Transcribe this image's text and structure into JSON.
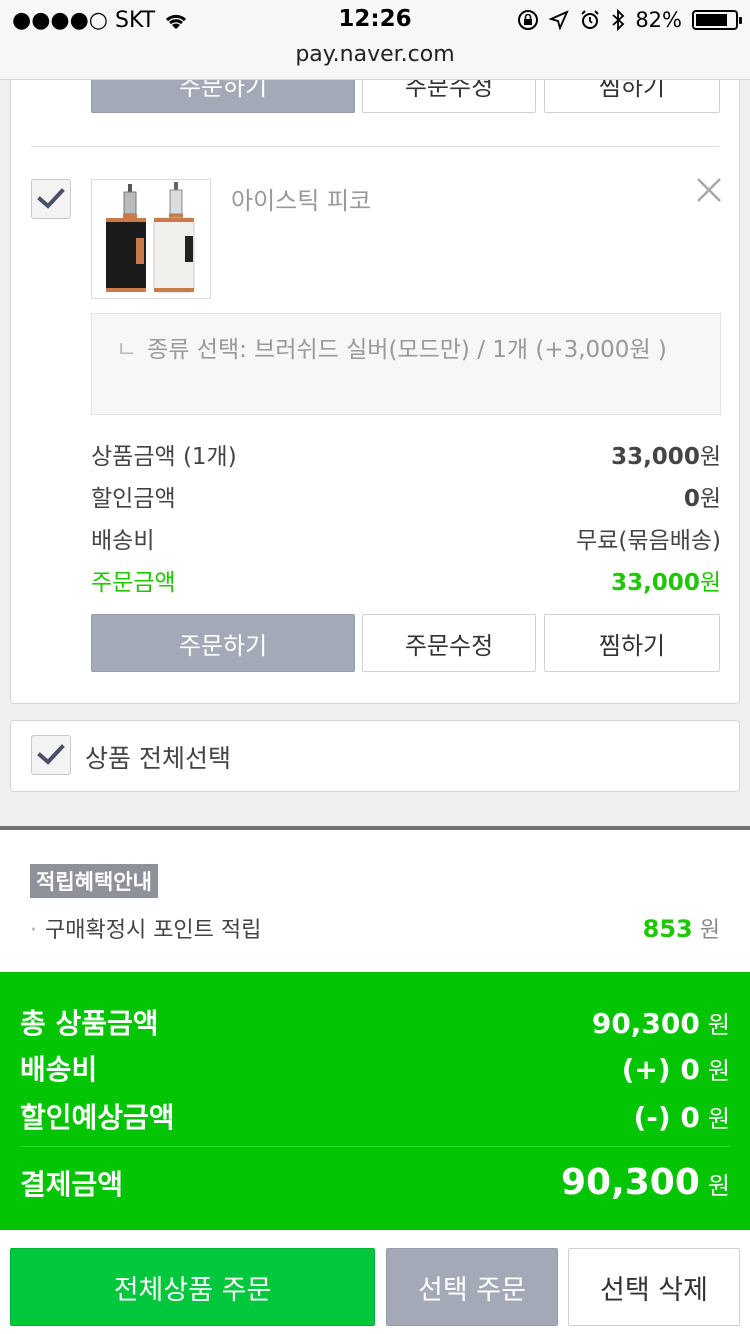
{
  "status": {
    "carrier": "●●●●○ SKT",
    "time": "12:26",
    "battery": "82%",
    "battery_level": 0.82,
    "url": "pay.naver.com"
  },
  "prev_item": {
    "order_label": "주문하기",
    "edit_label": "주문수정",
    "wish_label": "찜하기"
  },
  "item": {
    "name": "아이스틱 피코",
    "checked": true,
    "option_mark": "ㄴ",
    "option_text": "종류 선택: 브러쉬드 실버(모드만) / 1개 (+3,000원 )",
    "price_label": "상품금액 (1개)",
    "price_value": "33,000",
    "discount_label": "할인금액",
    "discount_value": "0",
    "shipping_label": "배송비",
    "shipping_value": "무료(묶음배송)",
    "order_amount_label": "주문금액",
    "order_amount_value": "33,000",
    "won": "원",
    "order_label": "주문하기",
    "edit_label": "주문수정",
    "wish_label": "찜하기"
  },
  "select_all": {
    "label": "상품 전체선택"
  },
  "benefit": {
    "tag": "적립혜택안내",
    "bullet": "·",
    "label": "구매확정시 포인트 적립",
    "points": "853",
    "unit": "원"
  },
  "summary": {
    "total_label": "총 상품금액",
    "total_value": "90,300",
    "shipping_label": "배송비",
    "shipping_value": "(+) 0",
    "discount_label": "할인예상금액",
    "discount_value": "(-) 0",
    "pay_label": "결제금액",
    "pay_value": "90,300",
    "unit": "원"
  },
  "bottom": {
    "order_all": "전체상품 주문",
    "order_selected": "선택 주문",
    "delete_selected": "선택 삭제"
  },
  "colors": {
    "naver_green": "#03c503",
    "button_green": "#01c73c",
    "accent_text_green": "#1ec800",
    "gray_button": "#a3a9b7"
  }
}
